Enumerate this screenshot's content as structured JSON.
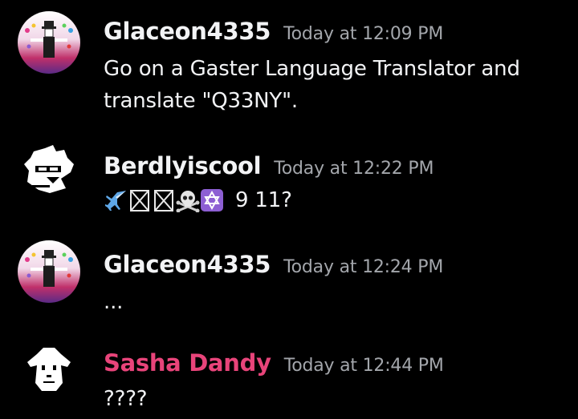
{
  "messages": [
    {
      "username": "Glaceon4335",
      "username_color": "#f2f3f5",
      "timestamp": "Today at 12:09 PM",
      "avatar_icon": "jester-avatar-icon",
      "lines": [
        "Go on a Gaster Language Translator and",
        "translate \"Q33NY\"."
      ]
    },
    {
      "username": "Berdlyiscool",
      "username_color": "#f2f3f5",
      "timestamp": "Today at 12:22 PM",
      "avatar_icon": "pixel-bird-avatar-icon",
      "emojis": [
        "airplane-emoji",
        "skyscraper-emoji",
        "skyscraper-emoji",
        "skull-crossbones-emoji",
        "star-of-david-emoji"
      ],
      "text": "9 11?"
    },
    {
      "username": "Glaceon4335",
      "username_color": "#f2f3f5",
      "timestamp": "Today at 12:24 PM",
      "avatar_icon": "jester-avatar-icon",
      "lines": [
        "..."
      ]
    },
    {
      "username": "Sasha Dandy",
      "username_color": "#e8447a",
      "timestamp": "Today at 12:44 PM",
      "avatar_icon": "pixel-goat-avatar-icon",
      "lines": [
        "????"
      ]
    }
  ]
}
